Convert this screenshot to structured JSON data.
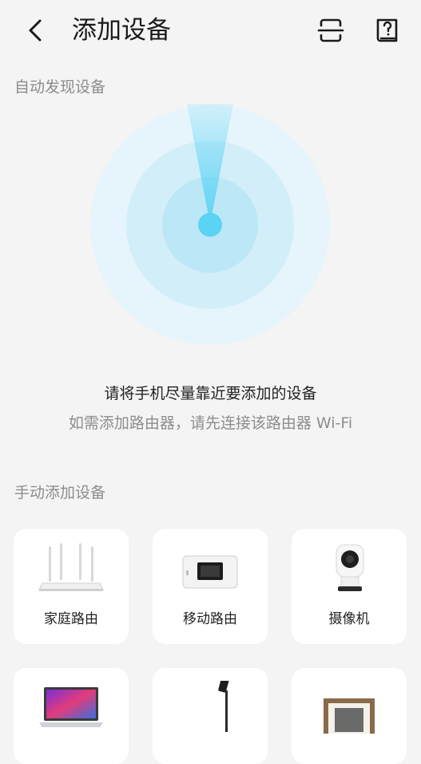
{
  "header": {
    "title": "添加设备",
    "back_icon": "chevron-left-icon",
    "scan_icon": "scan-icon",
    "help_icon": "help-book-icon"
  },
  "auto_discovery": {
    "section_label": "自动发现设备",
    "radar_color": "#5bd3f5",
    "tip_main": "请将手机尽量靠近要添加的设备",
    "tip_sub": "如需添加路由器，请先连接该路由器 Wi-Fi"
  },
  "manual": {
    "section_label": "手动添加设备",
    "devices": [
      {
        "label": "家庭路由",
        "icon": "home-router-icon"
      },
      {
        "label": "移动路由",
        "icon": "mobile-router-icon"
      },
      {
        "label": "摄像机",
        "icon": "camera-icon"
      },
      {
        "label": "",
        "icon": "laptop-icon"
      },
      {
        "label": "",
        "icon": "desk-lamp-icon"
      },
      {
        "label": "",
        "icon": "photo-frame-icon"
      }
    ]
  }
}
